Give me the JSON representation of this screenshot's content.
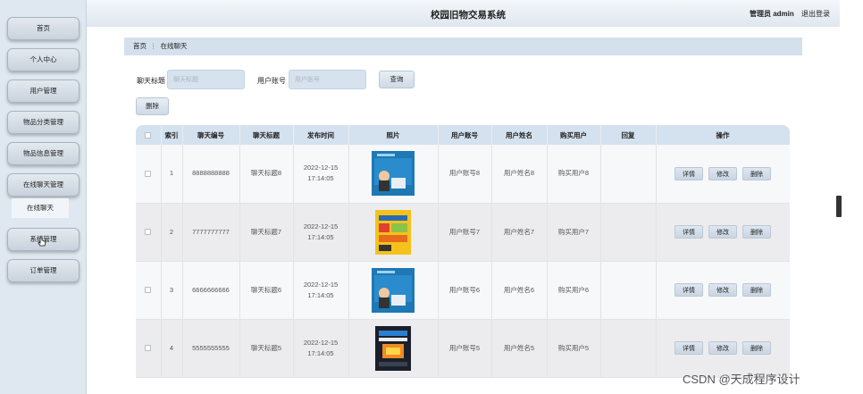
{
  "header": {
    "title": "校园旧物交易系统",
    "admin_label": "管理员 admin",
    "logout_label": "退出登录"
  },
  "sidebar": {
    "items": [
      {
        "label": "首页"
      },
      {
        "label": "个人中心"
      },
      {
        "label": "用户管理"
      },
      {
        "label": "物品分类管理"
      },
      {
        "label": "物品信息管理"
      },
      {
        "label": "在线聊天管理"
      },
      {
        "label": "系统管理"
      },
      {
        "label": "订单管理"
      }
    ],
    "submenu": {
      "label": "在线聊天"
    },
    "hover_item_label": "系统管理"
  },
  "breadcrumb": {
    "home": "首页",
    "separator": "⋮",
    "current": "在线聊天"
  },
  "search": {
    "title_label": "聊天标题",
    "title_placeholder": "聊天标题",
    "account_label": "用户账号",
    "account_placeholder": "用户账号",
    "query_button": "查询",
    "delete_button": "删除"
  },
  "table": {
    "columns": [
      "",
      "索引",
      "聊天编号",
      "聊天标题",
      "发布时间",
      "照片",
      "用户账号",
      "用户姓名",
      "购买用户",
      "回复",
      "操作"
    ],
    "actions": {
      "detail": "详情",
      "edit": "修改",
      "delete": "删除"
    },
    "rows": [
      {
        "index": "1",
        "chat_no": "8888888888",
        "chat_title": "聊天标题8",
        "time": "2022-12-15 17:14:05",
        "photo": "book-blue-cover",
        "account": "用户账号8",
        "name": "用户姓名8",
        "buyer": "购买用户8",
        "reply": ""
      },
      {
        "index": "2",
        "chat_no": "7777777777",
        "chat_title": "聊天标题7",
        "time": "2022-12-15 17:14:05",
        "photo": "book-yellow-cover",
        "account": "用户账号7",
        "name": "用户姓名7",
        "buyer": "购买用户7",
        "reply": ""
      },
      {
        "index": "3",
        "chat_no": "6666666666",
        "chat_title": "聊天标题6",
        "time": "2022-12-15 17:14:05",
        "photo": "book-blue-cover",
        "account": "用户账号6",
        "name": "用户姓名6",
        "buyer": "购买用户6",
        "reply": ""
      },
      {
        "index": "4",
        "chat_no": "5555555555",
        "chat_title": "聊天标题5",
        "time": "2022-12-15 17:14:05",
        "photo": "book-dark-cover",
        "account": "用户账号5",
        "name": "用户姓名5",
        "buyer": "购买用户5",
        "reply": ""
      }
    ]
  },
  "watermark": "CSDN @天成程序设计"
}
